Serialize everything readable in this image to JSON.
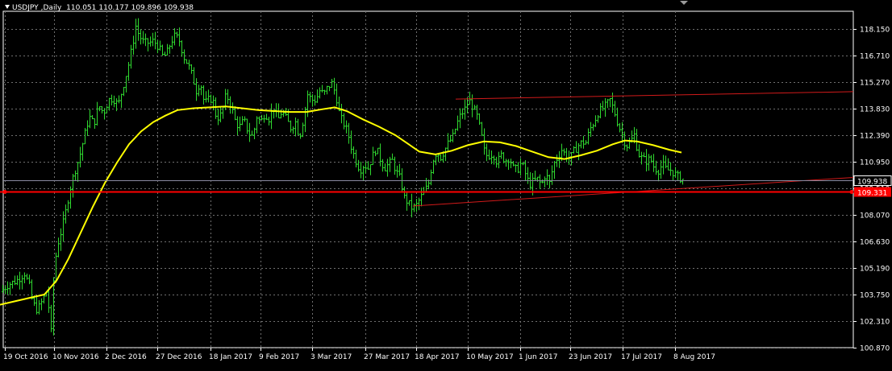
{
  "chart_data": {
    "type": "candlestick",
    "symbol": "USDJPY",
    "timeframe": "Daily",
    "header_sep": ",",
    "ohlc": {
      "open": "110.051",
      "high": "110.177",
      "low": "109.896",
      "close": "109.938"
    },
    "x_ticks": [
      "19 Oct 2016",
      "10 Nov 2016",
      "2 Dec 2016",
      "27 Dec 2016",
      "18 Jan 2017",
      "9 Feb 2017",
      "3 Mar 2017",
      "27 Mar 2017",
      "18 Apr 2017",
      "10 May 2017",
      "1 Jun 2017",
      "23 Jun 2017",
      "17 Jul 2017",
      "8 Aug 2017"
    ],
    "y_ticks": [
      "118.150",
      "116.710",
      "115.270",
      "113.830",
      "112.390",
      "110.950",
      "109.510",
      "108.070",
      "106.630",
      "105.190",
      "103.750",
      "102.310",
      "100.870"
    ],
    "ylim": [
      100.87,
      118.15
    ],
    "current_price_label": "109.938",
    "horizontal_level_label": "109.331",
    "horizontal_level": 109.331,
    "price_path": [
      [
        0,
        103.9
      ],
      [
        10,
        104.3
      ],
      [
        20,
        104.5
      ],
      [
        30,
        104.9
      ],
      [
        36,
        104.2
      ],
      [
        40,
        103.3
      ],
      [
        46,
        102.9
      ],
      [
        52,
        103.4
      ],
      [
        58,
        104.0
      ],
      [
        63,
        101.7
      ],
      [
        66,
        104.5
      ],
      [
        70,
        106.3
      ],
      [
        75,
        107.1
      ],
      [
        80,
        108.0
      ],
      [
        86,
        109.4
      ],
      [
        92,
        110.4
      ],
      [
        98,
        111.2
      ],
      [
        104,
        112.3
      ],
      [
        110,
        113.4
      ],
      [
        116,
        113.0
      ],
      [
        122,
        114.0
      ],
      [
        128,
        113.6
      ],
      [
        134,
        114.3
      ],
      [
        140,
        114.4
      ],
      [
        146,
        114.0
      ],
      [
        152,
        115.0
      ],
      [
        158,
        116.0
      ],
      [
        164,
        117.3
      ],
      [
        168,
        118.3
      ],
      [
        172,
        117.8
      ],
      [
        178,
        117.4
      ],
      [
        185,
        117.4
      ],
      [
        190,
        117.5
      ],
      [
        196,
        117.2
      ],
      [
        202,
        116.6
      ],
      [
        207,
        116.9
      ],
      [
        212,
        117.5
      ],
      [
        217,
        117.8
      ],
      [
        222,
        117.5
      ],
      [
        228,
        116.6
      ],
      [
        233,
        116.2
      ],
      [
        238,
        115.6
      ],
      [
        243,
        114.8
      ],
      [
        248,
        115.3
      ],
      [
        253,
        114.1
      ],
      [
        258,
        114.3
      ],
      [
        263,
        114.4
      ],
      [
        268,
        113.3
      ],
      [
        274,
        113.5
      ],
      [
        280,
        114.6
      ],
      [
        286,
        114.0
      ],
      [
        291,
        113.2
      ],
      [
        296,
        112.8
      ],
      [
        302,
        113.2
      ],
      [
        308,
        112.5
      ],
      [
        313,
        112.3
      ],
      [
        318,
        113.4
      ],
      [
        323,
        113.1
      ],
      [
        328,
        113.6
      ],
      [
        333,
        113.3
      ],
      [
        339,
        113.9
      ],
      [
        344,
        113.2
      ],
      [
        349,
        113.7
      ],
      [
        354,
        113.3
      ],
      [
        360,
        112.8
      ],
      [
        366,
        113.1
      ],
      [
        371,
        112.3
      ],
      [
        376,
        113.3
      ],
      [
        381,
        114.6
      ],
      [
        386,
        114.3
      ],
      [
        391,
        114.3
      ],
      [
        396,
        114.8
      ],
      [
        401,
        114.6
      ],
      [
        406,
        115.0
      ],
      [
        411,
        115.2
      ],
      [
        416,
        114.6
      ],
      [
        421,
        113.4
      ],
      [
        426,
        113.0
      ],
      [
        431,
        112.5
      ],
      [
        436,
        111.6
      ],
      [
        441,
        111.0
      ],
      [
        446,
        110.5
      ],
      [
        451,
        110.8
      ],
      [
        456,
        110.6
      ],
      [
        461,
        111.2
      ],
      [
        466,
        111.7
      ],
      [
        471,
        111.1
      ],
      [
        476,
        110.6
      ],
      [
        481,
        110.8
      ],
      [
        486,
        111.0
      ],
      [
        491,
        110.4
      ],
      [
        496,
        110.0
      ],
      [
        501,
        109.0
      ],
      [
        506,
        108.7
      ],
      [
        511,
        108.4
      ],
      [
        516,
        108.6
      ],
      [
        521,
        109.0
      ],
      [
        526,
        109.3
      ],
      [
        531,
        109.8
      ],
      [
        536,
        111.0
      ],
      [
        541,
        111.5
      ],
      [
        546,
        111.2
      ],
      [
        551,
        111.6
      ],
      [
        556,
        112.0
      ],
      [
        561,
        112.3
      ],
      [
        566,
        113.0
      ],
      [
        571,
        113.5
      ],
      [
        576,
        113.8
      ],
      [
        581,
        114.3
      ],
      [
        586,
        113.9
      ],
      [
        591,
        113.4
      ],
      [
        596,
        112.5
      ],
      [
        601,
        111.3
      ],
      [
        606,
        111.3
      ],
      [
        611,
        111.4
      ],
      [
        616,
        110.9
      ],
      [
        621,
        111.3
      ],
      [
        626,
        111.0
      ],
      [
        631,
        111.2
      ],
      [
        636,
        110.6
      ],
      [
        641,
        110.5
      ],
      [
        646,
        110.9
      ],
      [
        651,
        110.3
      ],
      [
        656,
        109.7
      ],
      [
        661,
        109.9
      ],
      [
        666,
        110.0
      ],
      [
        671,
        109.7
      ],
      [
        676,
        110.3
      ],
      [
        681,
        109.8
      ],
      [
        686,
        110.8
      ],
      [
        691,
        111.2
      ],
      [
        696,
        111.6
      ],
      [
        701,
        111.3
      ],
      [
        706,
        111.1
      ],
      [
        711,
        111.5
      ],
      [
        716,
        111.8
      ],
      [
        721,
        112.0
      ],
      [
        726,
        112.0
      ],
      [
        731,
        112.7
      ],
      [
        736,
        113.1
      ],
      [
        741,
        113.6
      ],
      [
        746,
        113.8
      ],
      [
        751,
        114.0
      ],
      [
        756,
        114.3
      ],
      [
        761,
        113.7
      ],
      [
        766,
        113.0
      ],
      [
        771,
        112.4
      ],
      [
        776,
        111.8
      ],
      [
        781,
        112.0
      ],
      [
        786,
        112.4
      ],
      [
        791,
        111.4
      ],
      [
        796,
        111.1
      ],
      [
        801,
        111.0
      ],
      [
        806,
        111.1
      ],
      [
        811,
        110.6
      ],
      [
        816,
        110.5
      ],
      [
        821,
        110.8
      ],
      [
        826,
        110.5
      ],
      [
        831,
        110.5
      ],
      [
        836,
        110.3
      ],
      [
        841,
        110.1
      ],
      [
        846,
        110.0
      ]
    ],
    "ma_path": [
      [
        0,
        103.2
      ],
      [
        20,
        103.4
      ],
      [
        40,
        103.6
      ],
      [
        55,
        103.75
      ],
      [
        70,
        104.5
      ],
      [
        85,
        105.7
      ],
      [
        100,
        107.1
      ],
      [
        115,
        108.5
      ],
      [
        130,
        109.8
      ],
      [
        145,
        110.9
      ],
      [
        160,
        111.9
      ],
      [
        175,
        112.6
      ],
      [
        190,
        113.1
      ],
      [
        205,
        113.45
      ],
      [
        220,
        113.75
      ],
      [
        240,
        113.85
      ],
      [
        260,
        113.9
      ],
      [
        280,
        113.95
      ],
      [
        300,
        113.85
      ],
      [
        320,
        113.75
      ],
      [
        340,
        113.7
      ],
      [
        360,
        113.65
      ],
      [
        380,
        113.65
      ],
      [
        400,
        113.8
      ],
      [
        415,
        113.9
      ],
      [
        430,
        113.7
      ],
      [
        450,
        113.25
      ],
      [
        470,
        112.85
      ],
      [
        490,
        112.4
      ],
      [
        505,
        111.95
      ],
      [
        520,
        111.5
      ],
      [
        540,
        111.35
      ],
      [
        560,
        111.55
      ],
      [
        580,
        111.85
      ],
      [
        600,
        112.05
      ],
      [
        620,
        112.0
      ],
      [
        640,
        111.8
      ],
      [
        660,
        111.5
      ],
      [
        680,
        111.2
      ],
      [
        700,
        111.1
      ],
      [
        720,
        111.3
      ],
      [
        740,
        111.55
      ],
      [
        760,
        111.9
      ],
      [
        775,
        112.1
      ],
      [
        790,
        112.05
      ],
      [
        810,
        111.85
      ],
      [
        830,
        111.6
      ],
      [
        845,
        111.45
      ]
    ],
    "trendlines": [
      {
        "from": [
          565,
          114.35
        ],
        "to": [
          1058,
          114.75
        ]
      },
      {
        "from": [
          512,
          108.55
        ],
        "to": [
          1058,
          110.1
        ]
      }
    ]
  }
}
